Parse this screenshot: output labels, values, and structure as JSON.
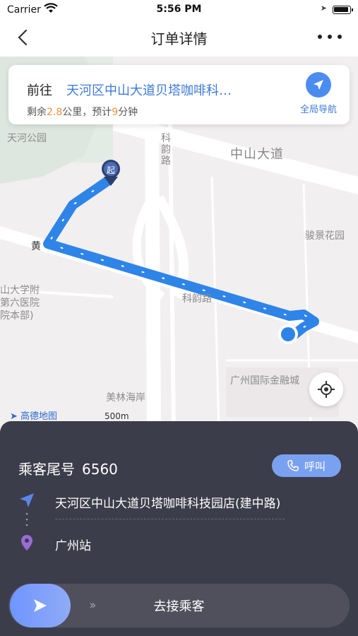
{
  "status_bar": {
    "carrier": "Carrier",
    "time": "5:56 PM"
  },
  "nav": {
    "title": "订单详情"
  },
  "map": {
    "labels": {
      "park": "天河公园",
      "road_zs": "中山大道",
      "road_ky": "科韵路",
      "road_ky_h": "科韵路",
      "junjing": "骏景花园",
      "hospital_l1": "山大学附",
      "hospital_l2": "第六医院",
      "hospital_l3": "院本部)",
      "ifc": "广州国际金融城",
      "meilin": "美林海岸",
      "huang": "黄"
    },
    "start_marker": "起",
    "amap_logo": "高德地图",
    "scale": "500m"
  },
  "route_card": {
    "goto": "前往",
    "destination": "天河区中山大道贝塔咖啡科…",
    "remain_prefix": "剩余",
    "remain_km": "2.8",
    "remain_mid": "公里，预计",
    "remain_min": "9",
    "remain_suffix": "分钟",
    "nav_label": "全局导航"
  },
  "panel": {
    "tail_label": "乘客尾号",
    "tail_number": "6560",
    "call_label": "呼叫",
    "start_address": "天河区中山大道贝塔咖啡科技园店(建中路)",
    "end_address": "广州站",
    "slider_label": "去接乘客"
  },
  "colors": {
    "accent": "#3d7bd9",
    "route": "#2f84e8",
    "panel": "#3c3d4a",
    "highlight": "#f2913d"
  }
}
